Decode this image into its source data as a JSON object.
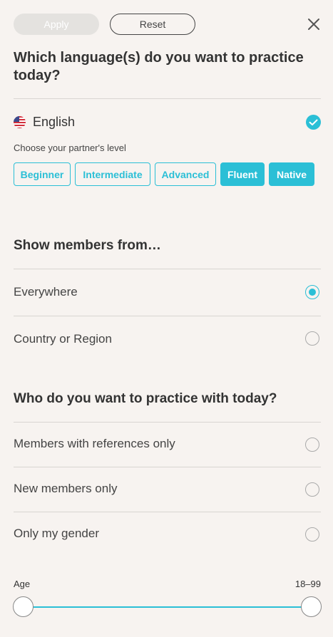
{
  "toolbar": {
    "apply_label": "Apply",
    "reset_label": "Reset"
  },
  "language_section": {
    "title": "Which language(s) do you want to practice today?",
    "language": "English",
    "flag_icon": "us-flag-icon",
    "partner_level_label": "Choose your partner's level",
    "levels": [
      {
        "label": "Beginner",
        "selected": false
      },
      {
        "label": "Intermediate",
        "selected": false
      },
      {
        "label": "Advanced",
        "selected": false
      },
      {
        "label": "Fluent",
        "selected": true
      },
      {
        "label": "Native",
        "selected": true
      }
    ]
  },
  "members_from": {
    "title": "Show members from…",
    "options": [
      {
        "label": "Everywhere",
        "selected": true
      },
      {
        "label": "Country or Region",
        "selected": false
      }
    ]
  },
  "practice_with": {
    "title": "Who do you want to practice with today?",
    "options": [
      {
        "label": "Members with references only",
        "selected": false
      },
      {
        "label": "New members only",
        "selected": false
      },
      {
        "label": "Only my gender",
        "selected": false
      }
    ]
  },
  "age": {
    "label": "Age",
    "range": "18–99",
    "min": 18,
    "max": 99
  },
  "colors": {
    "accent": "#2bbfd6",
    "background": "#f7f3f0"
  }
}
